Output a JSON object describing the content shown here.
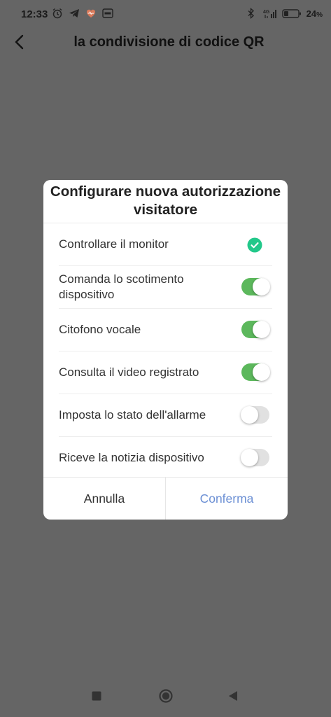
{
  "status_bar": {
    "time": "12:33",
    "left_icons": [
      "alarm-icon",
      "telegram-icon",
      "heart-icon",
      "app-badge-icon"
    ],
    "right_icons": [
      "bluetooth-icon",
      "network-4g-icon",
      "signal-icon",
      "battery-icon"
    ],
    "battery_percent": "24"
  },
  "header": {
    "back_icon": "chevron-left-icon",
    "title": "la condivisione di codice QR"
  },
  "dialog": {
    "title_line1": "Configurare nuova autorizzazione",
    "title_line2": "visitatore",
    "options": [
      {
        "label": "Controllare il monitor",
        "control": "check",
        "checked": true
      },
      {
        "label": "Comanda lo scotimento dispositivo",
        "control": "toggle",
        "checked": true
      },
      {
        "label": "Citofono vocale",
        "control": "toggle",
        "checked": true
      },
      {
        "label": "Consulta il video registrato",
        "control": "toggle",
        "checked": true
      },
      {
        "label": "Imposta lo stato dell'allarme",
        "control": "toggle",
        "checked": false
      },
      {
        "label": "Riceve la notizia dispositivo",
        "control": "toggle",
        "checked": false
      }
    ],
    "cancel_label": "Annulla",
    "confirm_label": "Conferma"
  },
  "nav_bar": {
    "icons": [
      "recent-apps-icon",
      "home-icon",
      "back-icon"
    ]
  },
  "colors": {
    "overlay": "#656565",
    "toggle_on": "#5cb85c",
    "toggle_off": "#e1e1e1",
    "check": "#22c88a",
    "confirm_text": "#6b8fd4"
  }
}
